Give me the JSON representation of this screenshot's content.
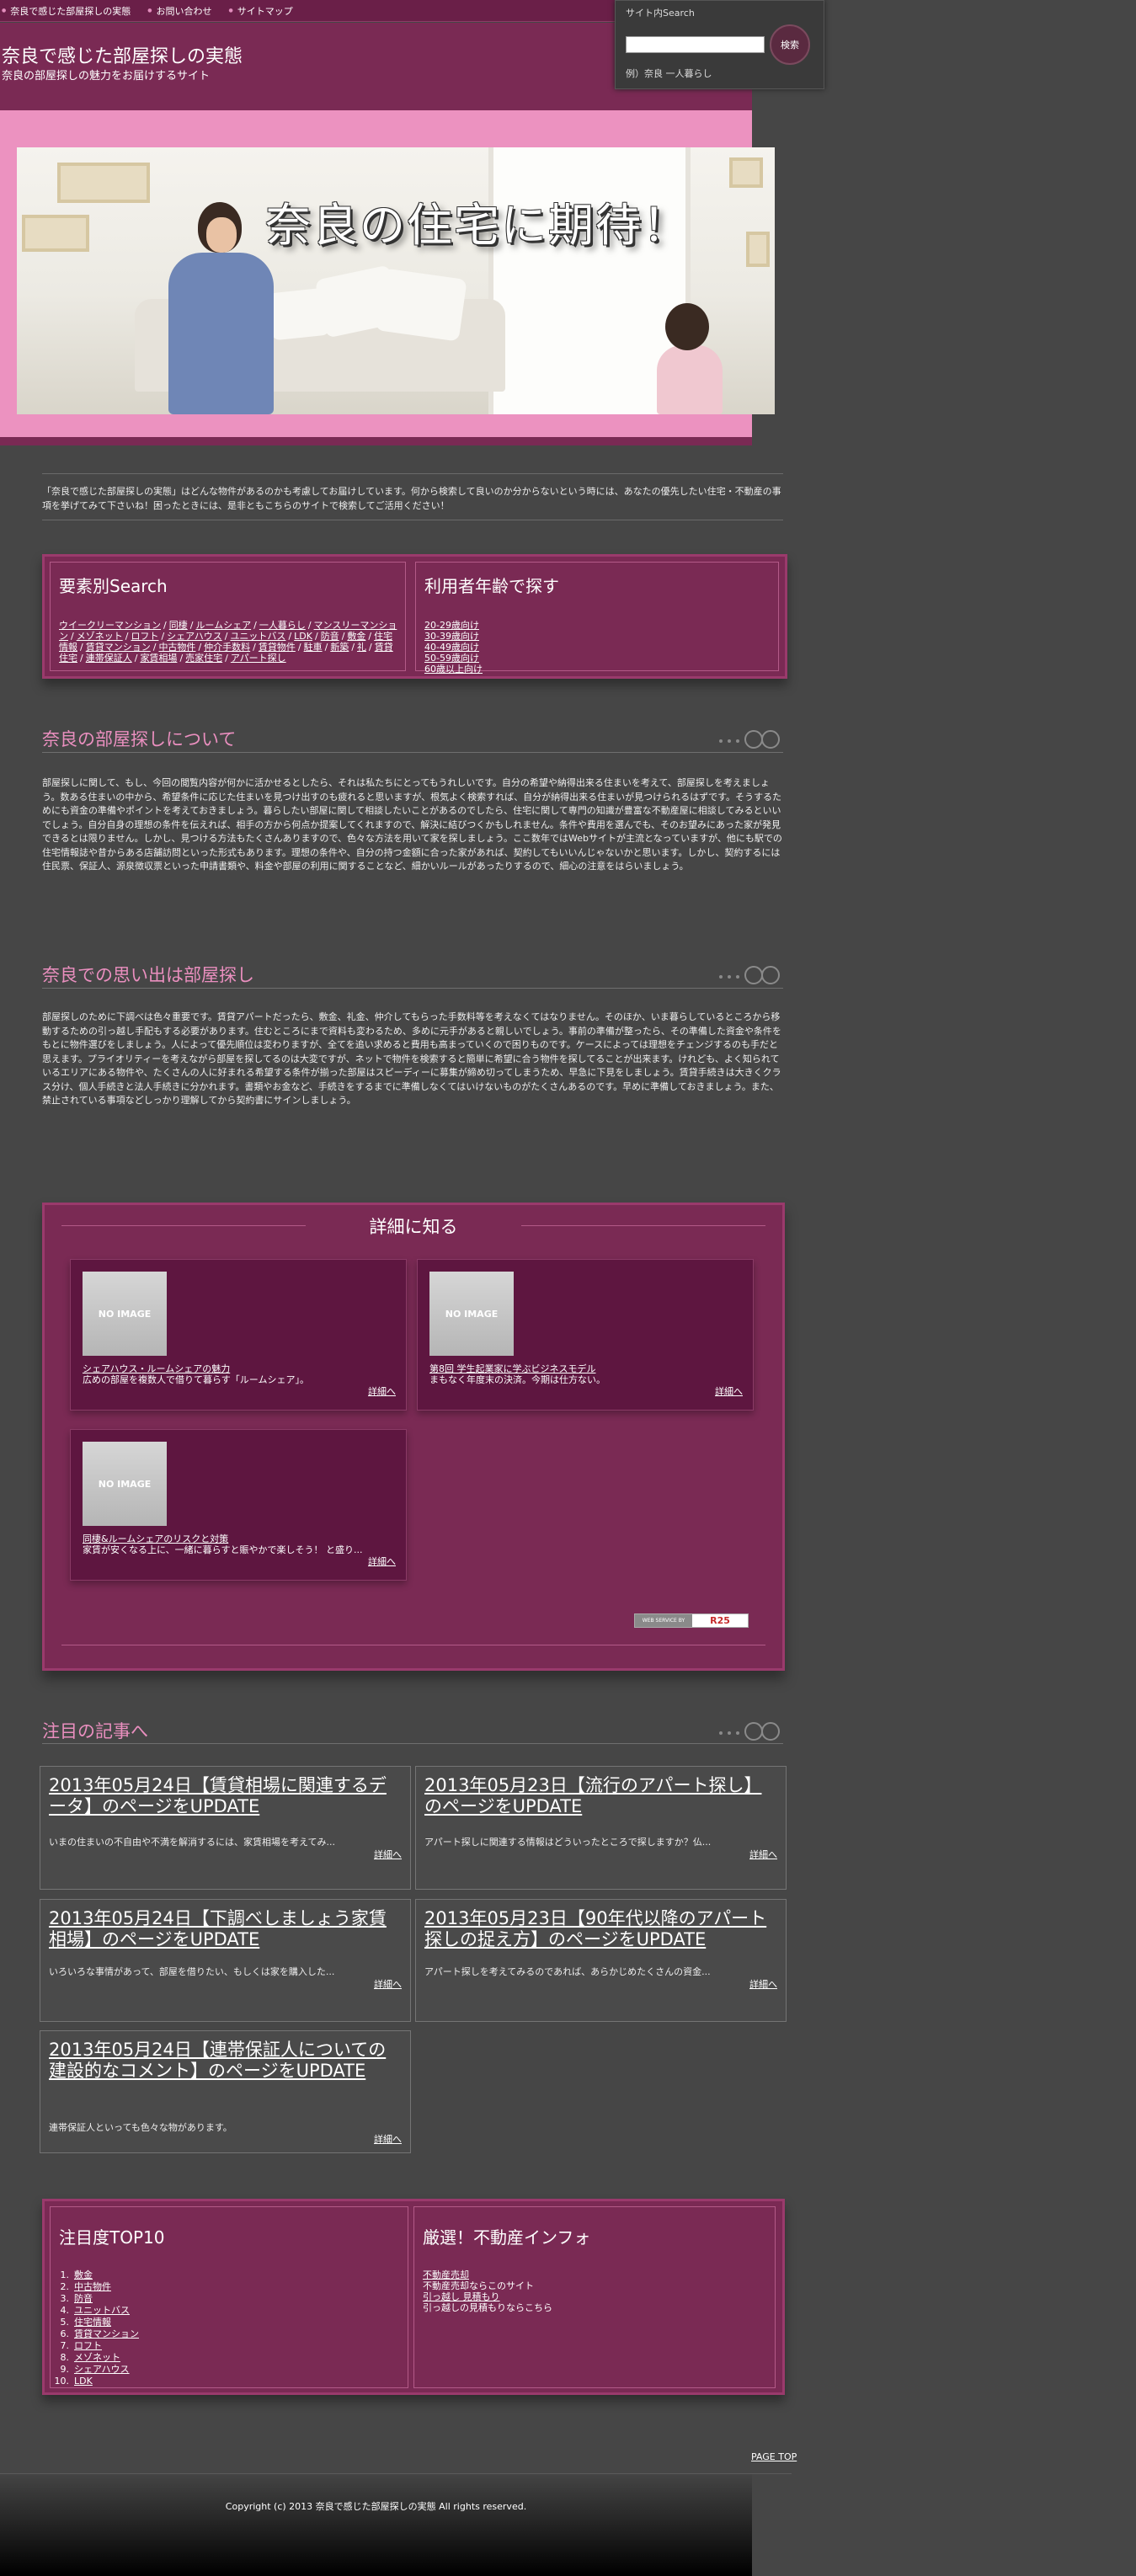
{
  "nav": {
    "items": [
      "奈良で感じた部屋探しの実態",
      "お問い合わせ",
      "サイトマップ"
    ]
  },
  "header": {
    "title": "奈良で感じた部屋探しの実態",
    "subtitle": "奈良の部屋探しの魅力をお届けするサイト"
  },
  "search": {
    "label": "サイト内Search",
    "button": "検索",
    "example": "例）奈良 一人暮らし"
  },
  "hero": {
    "banner_text": "奈良の住宅に期待！"
  },
  "intro": {
    "text": "「奈良で感じた部屋探しの実態」はどんな物件があるのかも考慮してお届けしています。何から検索して良いのか分からないという時には、あなたの優先したい住宅・不動産の事項を挙げてみて下さいね！困ったときには、是非ともこちらのサイトで検索してご活用ください！"
  },
  "search_panel": {
    "title": "要素別Search",
    "tags": [
      "ウイークリーマンション",
      "同棲",
      "ルームシェア",
      "一人暮らし",
      "マンスリーマンション",
      "メゾネット",
      "ロフト",
      "シェアハウス",
      "ユニットバス",
      "LDK",
      "防音",
      "敷金",
      "住宅情報",
      "賃貸マンション",
      "中古物件",
      "仲介手数料",
      "賃貸物件",
      "駐車",
      "新築",
      "礼",
      "賃貸住宅",
      "連帯保証人",
      "家賃相場",
      "売家住宅",
      "アパート探し"
    ]
  },
  "age_panel": {
    "title": "利用者年齢で探す",
    "items": [
      "20-29歳向け",
      "30-39歳向け",
      "40-49歳向け",
      "50-59歳向け",
      "60歳以上向け"
    ]
  },
  "section1": {
    "heading": "奈良の部屋探しについて",
    "text": "部屋探しに関して、もし、今回の閲覧内容が何かに活かせるとしたら、それは私たちにとってもうれしいです。自分の希望や納得出来る住まいを考えて、部屋探しを考えましょう。数ある住まいの中から、希望条件に応じた住まいを見つけ出すのも疲れると思いますが、根気よく検索すれば、自分が納得出来る住まいが見つけられるはずです。そうするためにも資金の準備やポイントを考えておきましょう。暮らしたい部屋に関して相談したいことがあるのでしたら、住宅に関して専門の知識が豊富な不動産屋に相談してみるといいでしょう。自分自身の理想の条件を伝えれば、相手の方から何点か提案してくれますので、解決に結びつくかもしれません。条件や費用を選んでも、そのお望みにあった家が発見できるとは限りません。しかし、見つける方法もたくさんありますので、色々な方法を用いて家を探しましょう。ここ数年ではWebサイトが主流となっていますが、他にも駅での住宅情報誌や昔からある店舗訪問といった形式もあります。理想の条件や、自分の持つ金額に合った家があれば、契約してもいいんじゃないかと思います。しかし、契約するには住民票、保証人、源泉徴収票といった申請書類や、料金や部屋の利用に関することなど、細かいルールがあったりするので、細心の注意をはらいましょう。"
  },
  "section2": {
    "heading": "奈良での思い出は部屋探し",
    "text": "部屋探しのために下調べは色々重要です。賃貸アパートだったら、敷金、礼金、仲介してもらった手数料等を考えなくてはなりません。そのほか、いま暮らしているところから移動するための引っ越し手配もする必要があります。住むところにまで資料も変わるため、多めに元手があると親しいでしょう。事前の準備が整ったら、その準備した資金や条件をもとに物件選びをしましょう。人によって優先順位は変わりますが、全てを追い求めると費用も高まっていくので困りものです。ケースによっては理想をチェンジするのも手だと思えます。プライオリティーを考えながら部屋を探してるのは大変ですが、ネットで物件を検索すると簡単に希望に合う物件を探してることが出来ます。けれども、よく知られているエリアにある物件や、たくさんの人に好まれる希望する条件が揃った部屋はスピーディーに募集が締め切ってしまうため、早急に下見をしましょう。賃貸手続きは大きくクラス分け、個人手続きと法人手続きに分かれます。書類やお金など、手続きをするまでに準備しなくてはいけないものがたくさんあるのです。早めに準備しておきましょう。また、禁止されている事項などしっかり理解してから契約書にサインしましょう。"
  },
  "detail": {
    "heading": "詳細に知る",
    "noimage": "NO IMAGE",
    "more": "詳細へ",
    "cards": [
      {
        "title": "シェアハウス・ルームシェアの魅力",
        "desc": "広めの部屋を複数人で借りて暮らす「ルームシェア」。"
      },
      {
        "title": "第8回 学生起業家に学ぶビジネスモデル",
        "desc": "まもなく年度末の決済。今期は仕方ない。"
      },
      {
        "title": "同棲&ルームシェアのリスクと対策",
        "desc": "家賃が安くなる上に、一緒に暮らすと賑やかで楽しそう！ と盛り..."
      }
    ],
    "powered_left": "WEB SERVICE BY",
    "powered_right": "R25"
  },
  "news": {
    "heading": "注目の記事へ",
    "more": "詳細へ",
    "items": [
      {
        "title": "2013年05月24日【賃貸相場に関連するデータ】のページをUPDATE",
        "desc": "いまの住まいの不自由や不満を解消するには、家賃相場を考えてみ..."
      },
      {
        "title": "2013年05月23日【流行のアパート探し】のページをUPDATE",
        "desc": "アパート探しに関連する情報はどういったところで探しますか？仏..."
      },
      {
        "title": "2013年05月24日【下調べしましょう家賃相場】のページをUPDATE",
        "desc": "いろいろな事情があって、部屋を借りたい、もしくは家を購入した..."
      },
      {
        "title": "2013年05月23日【90年代以降のアパート探しの捉え方】のページをUPDATE",
        "desc": "アパート探しを考えてみるのであれば、あらかじめたくさんの資金..."
      },
      {
        "title": "2013年05月24日【連帯保証人についての建設的なコメント】のページをUPDATE",
        "desc": "連帯保証人といっても色々な物があります。"
      }
    ]
  },
  "top10": {
    "title": "注目度TOP10",
    "items": [
      "敷金",
      "中古物件",
      "防音",
      "ユニットバス",
      "住宅情報",
      "賃貸マンション",
      "ロフト",
      "メゾネット",
      "シェアハウス",
      "LDK"
    ]
  },
  "info": {
    "title": "厳選！不動産インフォ",
    "lines": [
      {
        "text": "不動産売却",
        "link": true
      },
      {
        "text": "不動産売却ならこのサイト",
        "link": false
      },
      {
        "text": "引っ越し 見積もり",
        "link": true
      },
      {
        "text": "引っ越しの見積もりならこちら",
        "link": false
      }
    ]
  },
  "footer": {
    "pagetop": "PAGE TOP",
    "copyright": "Copyright (c) 2013 奈良で感じた部屋探しの実態 All rights reserved."
  },
  "colors": {
    "background": "#464646",
    "header": "#7a2a54",
    "hero_band": "#ec92c0",
    "accent_heading": "#ea8fbf"
  }
}
